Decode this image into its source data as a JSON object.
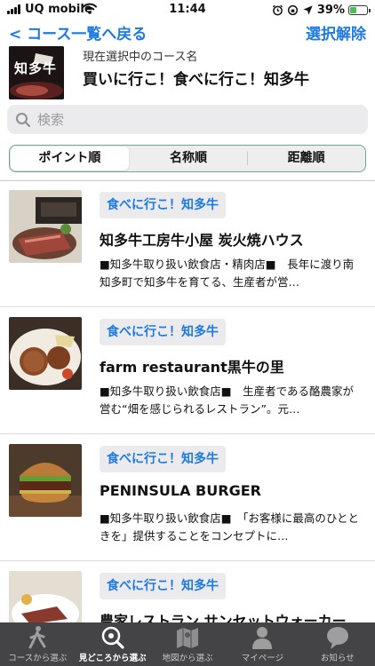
{
  "status_bar": {
    "carrier": "UQ mobile",
    "time": "11:44",
    "battery_percent": "39%",
    "battery_level": 0.39,
    "icons": [
      "signal-icon",
      "wifi-icon",
      "alarm-icon",
      "location-icon",
      "battery-icon"
    ]
  },
  "nav": {
    "back_label": "< コース一覧へ戻る",
    "clear_label": "選択解除"
  },
  "current_course": {
    "label": "現在選択中のコース名",
    "name": "買いに行こ！食べに行こ！知多牛",
    "thumbnail_text": "知多牛"
  },
  "search": {
    "placeholder": "検索",
    "value": ""
  },
  "sort_tabs": [
    {
      "label": "ポイント順",
      "selected": true
    },
    {
      "label": "名称順",
      "selected": false
    },
    {
      "label": "距離順",
      "selected": false
    }
  ],
  "spots": [
    {
      "tag": "食べに行こ！知多牛",
      "title": "知多牛工房牛小屋 炭火焼ハウス",
      "description": "■知多牛取り扱い飲食店・精肉店■　長年に渡り南知多町で知多牛を育てる、生産者が営…"
    },
    {
      "tag": "食べに行こ！知多牛",
      "title": "farm restaurant黒牛の里",
      "description": "■知多牛取り扱い飲食店■　生産者である酪農家が営む“畑を感じられるレストラン”。元…"
    },
    {
      "tag": "食べに行こ！知多牛",
      "title": "PENINSULA BURGER",
      "description": "■知多牛取り扱い飲食店■　「お客様に最高のひとときを」提供することをコンセプトに…"
    },
    {
      "tag": "食べに行こ！知多牛",
      "title": "農家レストラン サンセットウォーカー",
      "description": ""
    }
  ],
  "tab_bar": [
    {
      "label": "コースから選ぶ",
      "icon": "walking-person-icon",
      "active": false
    },
    {
      "label": "見どころから選ぶ",
      "icon": "spot-search-icon",
      "active": true
    },
    {
      "label": "地図から選ぶ",
      "icon": "map-icon",
      "active": false
    },
    {
      "label": "マイページ",
      "icon": "user-icon",
      "active": false
    },
    {
      "label": "お知らせ",
      "icon": "chat-bubble-icon",
      "active": false
    }
  ],
  "colors": {
    "accent": "#1f7ae0",
    "segment_border": "#6aa891",
    "tab_bar_bg": "#444446",
    "battery": "#44c15a"
  }
}
